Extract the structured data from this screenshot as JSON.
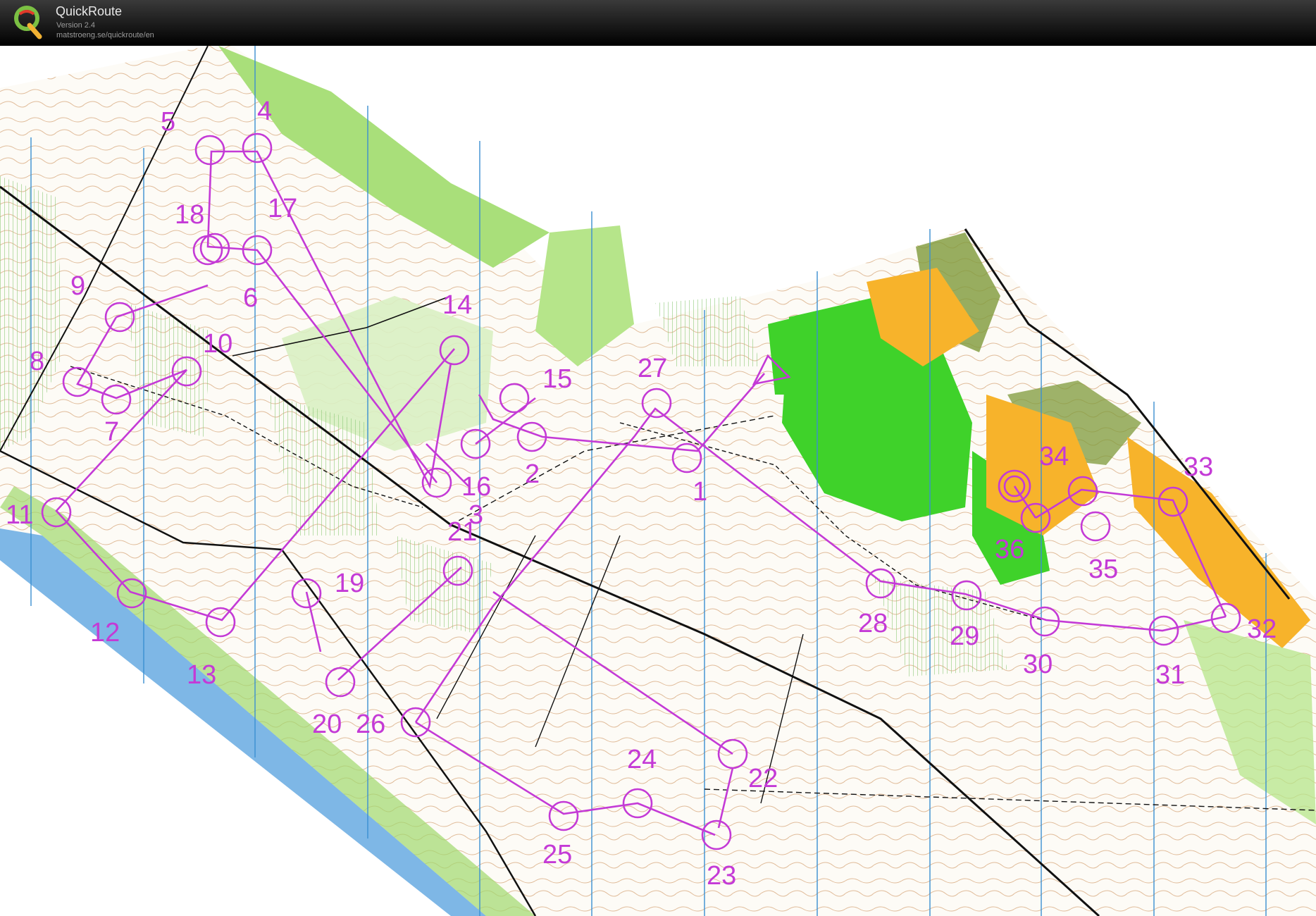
{
  "app": {
    "name": "QuickRoute",
    "version": "Version 2.4",
    "url": "matstroeng.se/quickroute/en",
    "logo_icon": "quickroute-q-logo"
  },
  "map": {
    "description_colors": {
      "course": "#c43ad6",
      "water": "#7eb7e6",
      "forest_green": "#3fd22a",
      "light_green": "#b6e58a",
      "open_yellow": "#f7b32b",
      "contour_brown": "#b8692e",
      "meridian_blue": "#3b8fd1"
    },
    "controls": [
      "1",
      "2",
      "3",
      "4",
      "5",
      "6",
      "7",
      "8",
      "9",
      "10",
      "11",
      "12",
      "13",
      "14",
      "15",
      "16",
      "17",
      "18",
      "19",
      "20",
      "21",
      "22",
      "23",
      "24",
      "25",
      "26",
      "27",
      "28",
      "29",
      "30",
      "31",
      "32",
      "33",
      "34",
      "35",
      "36"
    ]
  }
}
